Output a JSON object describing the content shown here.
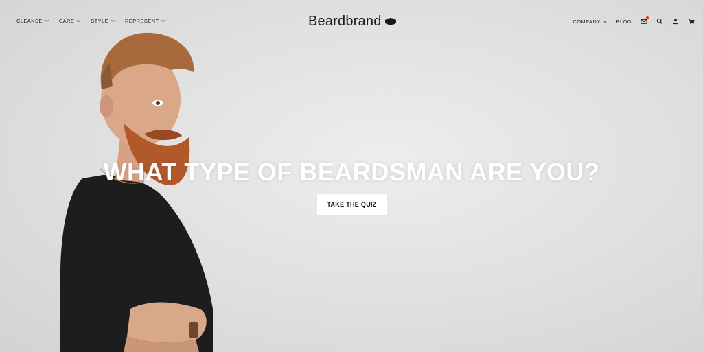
{
  "nav": {
    "left": [
      {
        "label": "CLEANSE"
      },
      {
        "label": "CARE"
      },
      {
        "label": "STYLE"
      },
      {
        "label": "REPRESENT"
      }
    ],
    "right": {
      "company": "COMPANY",
      "blog": "BLOG"
    }
  },
  "brand": {
    "name": "Beardbrand"
  },
  "hero": {
    "headline": "WHAT TYPE OF BEARDSMAN ARE YOU?",
    "cta_label": "TAKE THE QUIZ"
  },
  "colors": {
    "background": "#e5e5e5",
    "headline": "#ffffff",
    "cta_bg": "#ffffff",
    "notification_dot": "#e0342c"
  },
  "icons": [
    "chevron-down-icon",
    "mail-icon",
    "search-icon",
    "user-icon",
    "cart-icon",
    "mustache-icon"
  ]
}
